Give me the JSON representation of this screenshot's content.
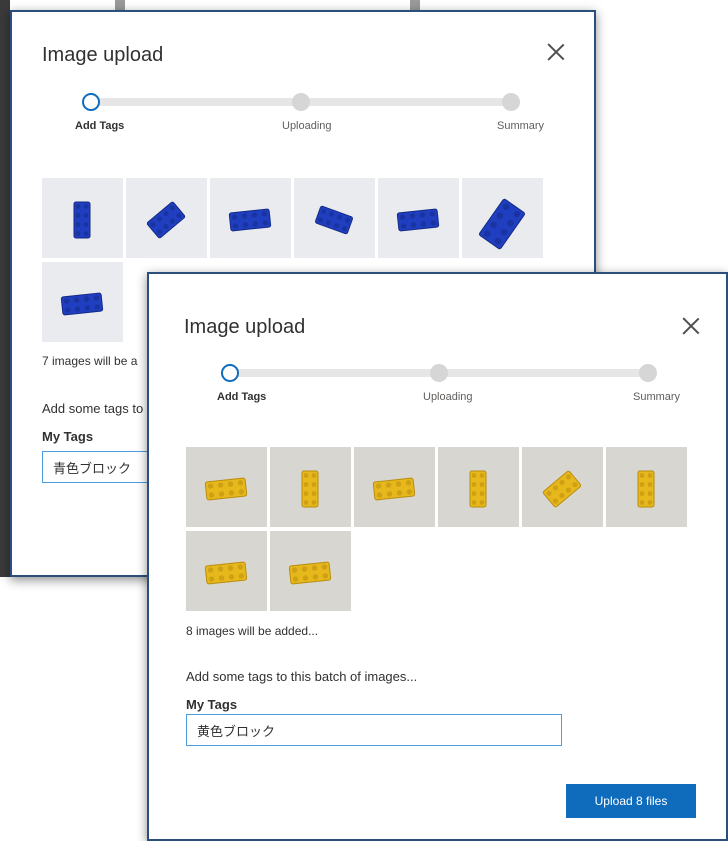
{
  "colors": {
    "accent": "#0f6cbd",
    "blue_brick": "#1f3fc0",
    "yellow_brick": "#e7b81c"
  },
  "back_dialog": {
    "title": "Image upload",
    "close_icon": "close-icon",
    "steps": [
      {
        "label": "Add Tags",
        "state": "active"
      },
      {
        "label": "Uploading",
        "state": "pending"
      },
      {
        "label": "Summary",
        "state": "pending"
      }
    ],
    "thumbnails": [
      {
        "color": "blue",
        "pose": "upright"
      },
      {
        "color": "blue",
        "pose": "diagonal"
      },
      {
        "color": "blue",
        "pose": "flat"
      },
      {
        "color": "blue",
        "pose": "tilted"
      },
      {
        "color": "blue",
        "pose": "flat"
      },
      {
        "color": "blue",
        "pose": "diagonal-large"
      },
      {
        "color": "blue",
        "pose": "flat"
      }
    ],
    "status": "7 images will be a",
    "instruction": "Add some tags to",
    "tags_label": "My Tags",
    "tags_value": "青色ブロック"
  },
  "front_dialog": {
    "title": "Image upload",
    "close_icon": "close-icon",
    "steps": [
      {
        "label": "Add Tags",
        "state": "active"
      },
      {
        "label": "Uploading",
        "state": "pending"
      },
      {
        "label": "Summary",
        "state": "pending"
      }
    ],
    "thumbnails": [
      {
        "color": "yellow",
        "pose": "flat"
      },
      {
        "color": "yellow",
        "pose": "upright"
      },
      {
        "color": "yellow",
        "pose": "flat"
      },
      {
        "color": "yellow",
        "pose": "upright"
      },
      {
        "color": "yellow",
        "pose": "diagonal"
      },
      {
        "color": "yellow",
        "pose": "upright"
      },
      {
        "color": "yellow",
        "pose": "flat"
      },
      {
        "color": "yellow",
        "pose": "flat"
      }
    ],
    "status": "8 images will be added...",
    "instruction": "Add some tags to this batch of images...",
    "tags_label": "My Tags",
    "tags_value": "黄色ブロック",
    "upload_button": "Upload 8 files"
  },
  "background_fragments": [
    "a",
    "w"
  ]
}
